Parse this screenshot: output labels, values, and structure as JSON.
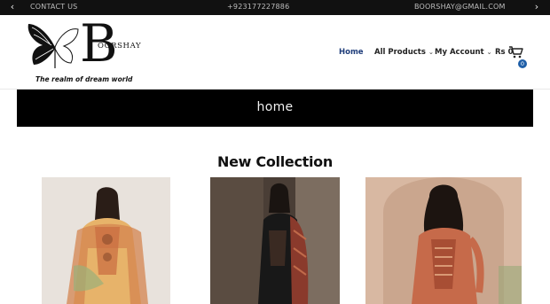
{
  "topbar": {
    "contact_label": "CONTACT US",
    "phone": "+923177227886",
    "email": "BOORSHAY@GMAIL.COM",
    "prev_icon": "chevron-left-icon",
    "next_icon": "chevron-right-icon"
  },
  "logo": {
    "brand": "OORSHAY",
    "letter": "B",
    "tagline": "The realm of  dream world"
  },
  "nav": {
    "home": "Home",
    "products": "All Products",
    "account": "My Account"
  },
  "cart": {
    "price": "Rs 0",
    "count": "0",
    "icon": "shopping-cart-icon"
  },
  "banner": {
    "title": "home"
  },
  "sections": {
    "new_collection": "New Collection"
  },
  "colors": {
    "topbar": "#111111",
    "accent_nav": "#1f3d7a",
    "badge": "#1f5fa8"
  }
}
